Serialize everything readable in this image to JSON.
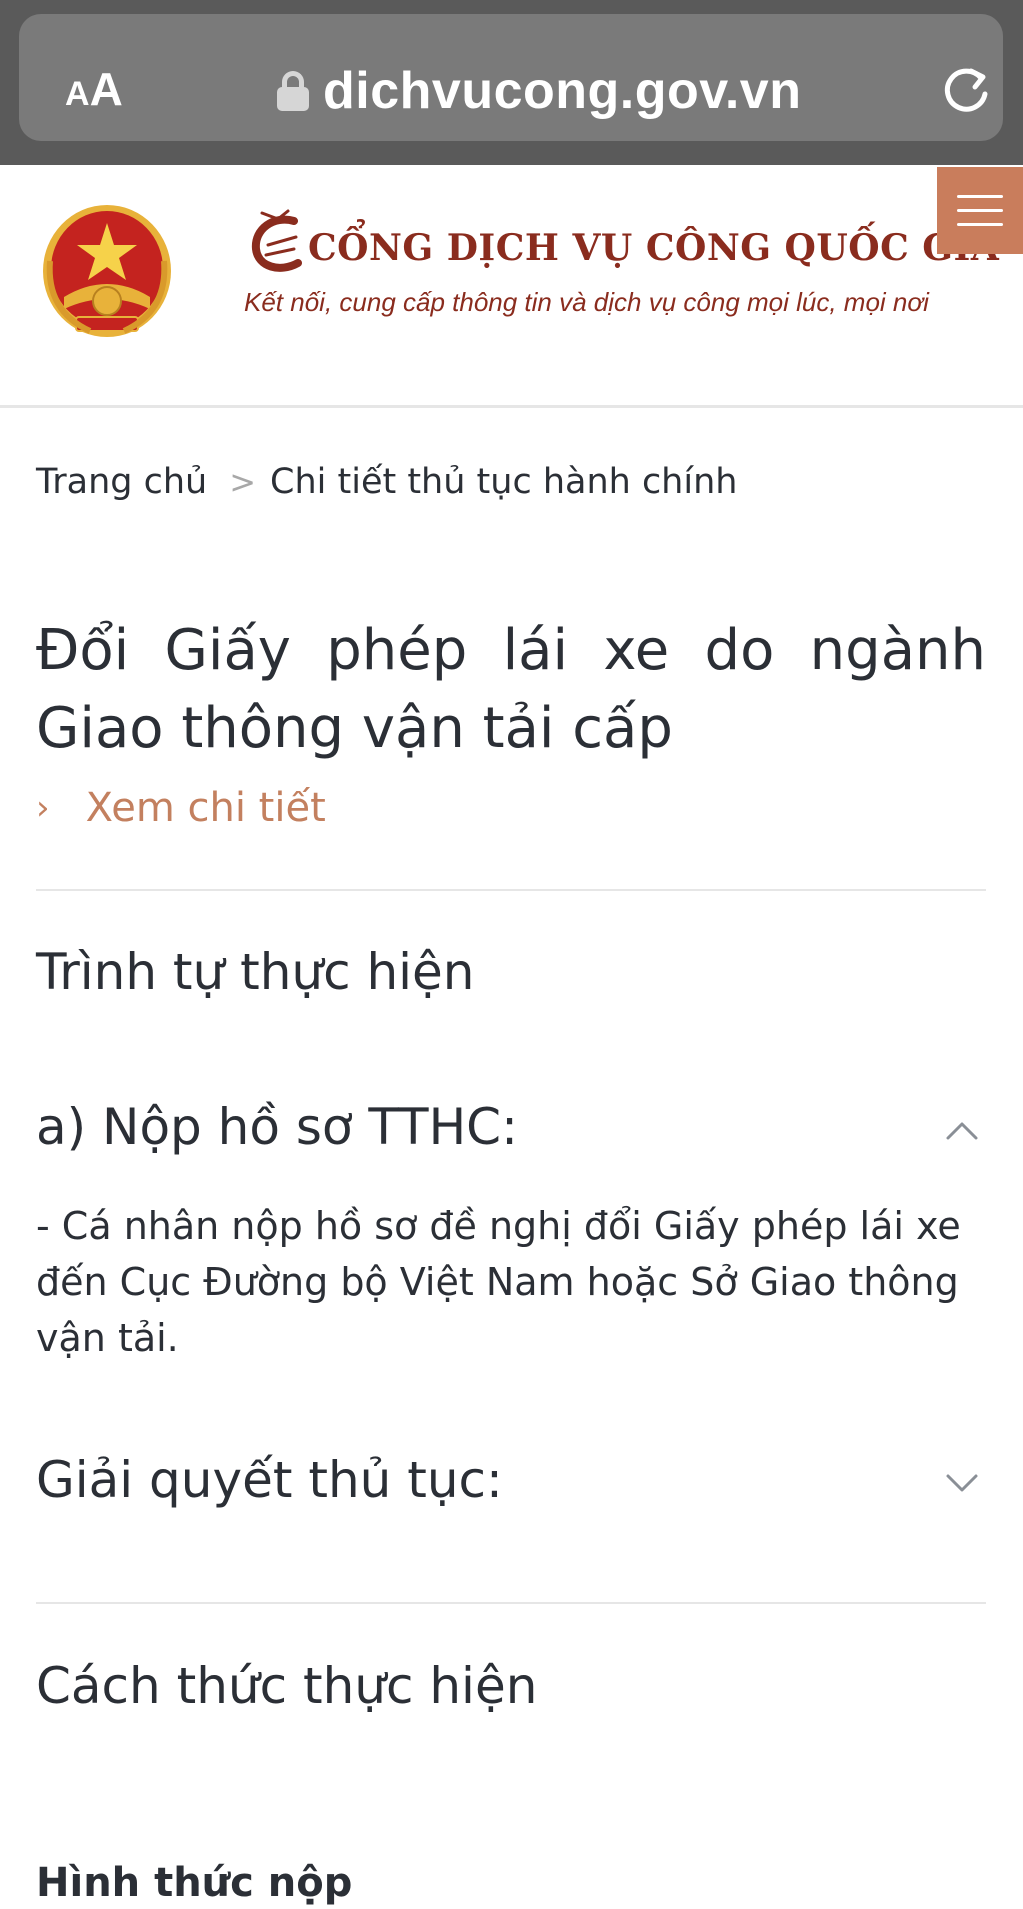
{
  "browser": {
    "text_size_label_small": "A",
    "text_size_label_large": "A",
    "url": "dichvucong.gov.vn"
  },
  "header": {
    "title": "CỔNG DỊCH VỤ CÔNG QUỐC GIA",
    "slogan": "Kết nối, cung cấp thông tin và dịch vụ công mọi lúc, mọi nơi",
    "brand_color": "#8a2c1e",
    "menu_color": "#c97d5c"
  },
  "breadcrumb": {
    "home": "Trang chủ",
    "separator": ">",
    "current": "Chi tiết thủ tục hành chính"
  },
  "procedure": {
    "title": "Đổi Giấy phép lái xe do ngành Giao thông vận tải cấp",
    "detail_link": "Xem chi tiết",
    "link_color": "#c3805f"
  },
  "sections": {
    "sequence": {
      "heading": "Trình tự thực hiện",
      "step_a": {
        "title": "a) Nộp hồ sơ TTHC:",
        "expanded": true,
        "body": "- Cá nhân nộp hồ sơ đề nghị đổi Giấy phép lái xe đến Cục Đường bộ Việt Nam hoặc Sở Giao thông vận tải."
      },
      "step_b": {
        "title": "Giải quyết thủ tục:",
        "expanded": false
      }
    },
    "method": {
      "heading": "Cách thức thực hiện",
      "sub_heading": "Hình thức nộp"
    }
  }
}
